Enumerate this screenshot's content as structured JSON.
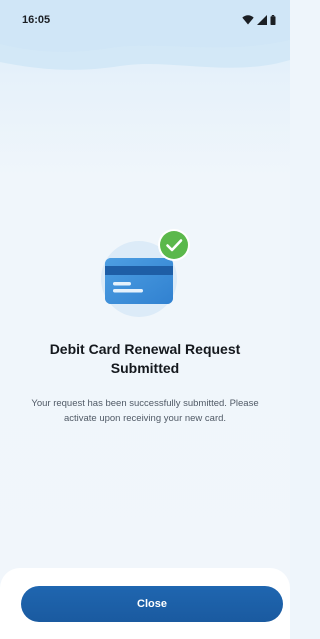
{
  "status_bar": {
    "time": "16:05",
    "icons": [
      "wifi-icon",
      "cellular-signal-icon",
      "battery-icon"
    ]
  },
  "illustration": {
    "icon": "credit-card-icon",
    "badge_icon": "check-icon",
    "card_color": "#3b8fd9",
    "badge_color": "#59b74a"
  },
  "main": {
    "title": "Debit Card Renewal Request Submitted",
    "message": "Your request has been successfully submitted. Please activate upon receiving your new card."
  },
  "footer": {
    "close_label": "Close",
    "button_color": "#1d61aa"
  }
}
